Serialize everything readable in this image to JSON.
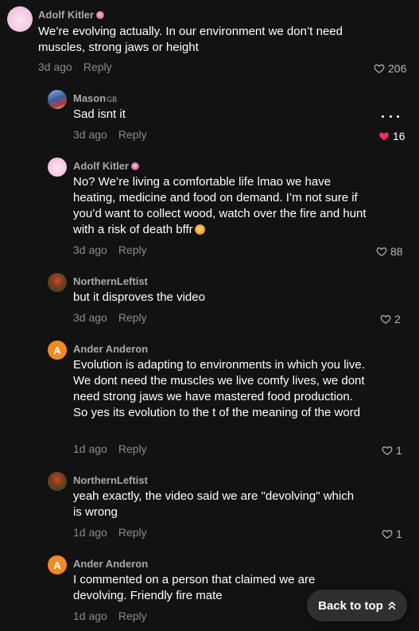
{
  "comments": [
    {
      "username": "Adolf Kitler",
      "text": "We’re evolving actually. In our environment we don’t need muscles, strong jaws or height",
      "time": "3d ago",
      "reply": "Reply",
      "likes": "206"
    },
    {
      "username": "Mason",
      "tag": "GB",
      "text": "Sad isnt it",
      "time": "3d ago",
      "reply": "Reply",
      "likes": "16"
    },
    {
      "username": "Adolf Kitler",
      "text": "No? We’re living a comfortable life lmao we have heating, medicine and food on demand. I’m not sure if you’d want to collect wood, watch over the fire and hunt with a risk of death bffr",
      "time": "3d ago",
      "reply": "Reply",
      "likes": "88"
    },
    {
      "username": "NorthernLeftist",
      "text": "but it disproves the video",
      "time": "3d ago",
      "reply": "Reply",
      "likes": "2"
    },
    {
      "username": "Ander Anderon",
      "avatar_letter": "A",
      "text": "Evolution is adapting to environments in which you live. We dont need the muscles we live comfy lives, we dont need strong jaws we have mastered food production. So yes its evolution to the t of the meaning of the word",
      "time": "1d ago",
      "reply": "Reply",
      "likes": "1"
    },
    {
      "username": "NorthernLeftist",
      "text": "yeah exactly, the video said we are \"devolving\" which is wrong",
      "time": "1d ago",
      "reply": "Reply",
      "likes": "1"
    },
    {
      "username": "Ander Anderon",
      "avatar_letter": "A",
      "text": "I commented on a person that claimed we are devolving. Friendly fire mate",
      "time": "1d ago",
      "reply": "Reply"
    }
  ],
  "back_to_top": "Back to top",
  "colors": {
    "background": "#121212",
    "liked_heart": "#fe2c55",
    "avatar_letter_bg": "#f08a24"
  },
  "icons": [
    "heart-outline-icon",
    "heart-filled-icon",
    "more-dots-icon",
    "double-chevron-up-icon"
  ]
}
